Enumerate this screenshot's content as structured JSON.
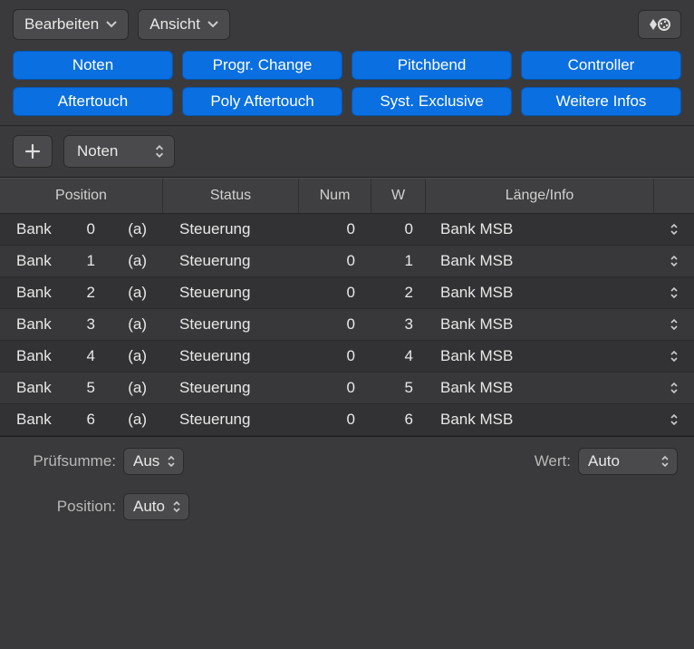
{
  "menus": {
    "edit": "Bearbeiten",
    "view": "Ansicht"
  },
  "filters": [
    [
      "Noten",
      "Progr. Change",
      "Pitchbend",
      "Controller"
    ],
    [
      "Aftertouch",
      "Poly Aftertouch",
      "Syst. Exclusive",
      "Weitere Infos"
    ]
  ],
  "addSelect": "Noten",
  "columns": {
    "position": "Position",
    "status": "Status",
    "num": "Num",
    "w": "W",
    "length": "Länge/Info"
  },
  "rows": [
    {
      "bank": "Bank",
      "n": "0",
      "ch": "(a)",
      "status": "Steuerung",
      "num": "0",
      "w": "0",
      "len": "Bank MSB"
    },
    {
      "bank": "Bank",
      "n": "1",
      "ch": "(a)",
      "status": "Steuerung",
      "num": "0",
      "w": "1",
      "len": "Bank MSB"
    },
    {
      "bank": "Bank",
      "n": "2",
      "ch": "(a)",
      "status": "Steuerung",
      "num": "0",
      "w": "2",
      "len": "Bank MSB"
    },
    {
      "bank": "Bank",
      "n": "3",
      "ch": "(a)",
      "status": "Steuerung",
      "num": "0",
      "w": "3",
      "len": "Bank MSB"
    },
    {
      "bank": "Bank",
      "n": "4",
      "ch": "(a)",
      "status": "Steuerung",
      "num": "0",
      "w": "4",
      "len": "Bank MSB"
    },
    {
      "bank": "Bank",
      "n": "5",
      "ch": "(a)",
      "status": "Steuerung",
      "num": "0",
      "w": "5",
      "len": "Bank MSB"
    },
    {
      "bank": "Bank",
      "n": "6",
      "ch": "(a)",
      "status": "Steuerung",
      "num": "0",
      "w": "6",
      "len": "Bank MSB"
    }
  ],
  "footer": {
    "checksum_label": "Prüfsumme:",
    "checksum_value": "Aus",
    "position_label": "Position:",
    "position_value": "Auto",
    "value_label": "Wert:",
    "value_value": "Auto"
  }
}
